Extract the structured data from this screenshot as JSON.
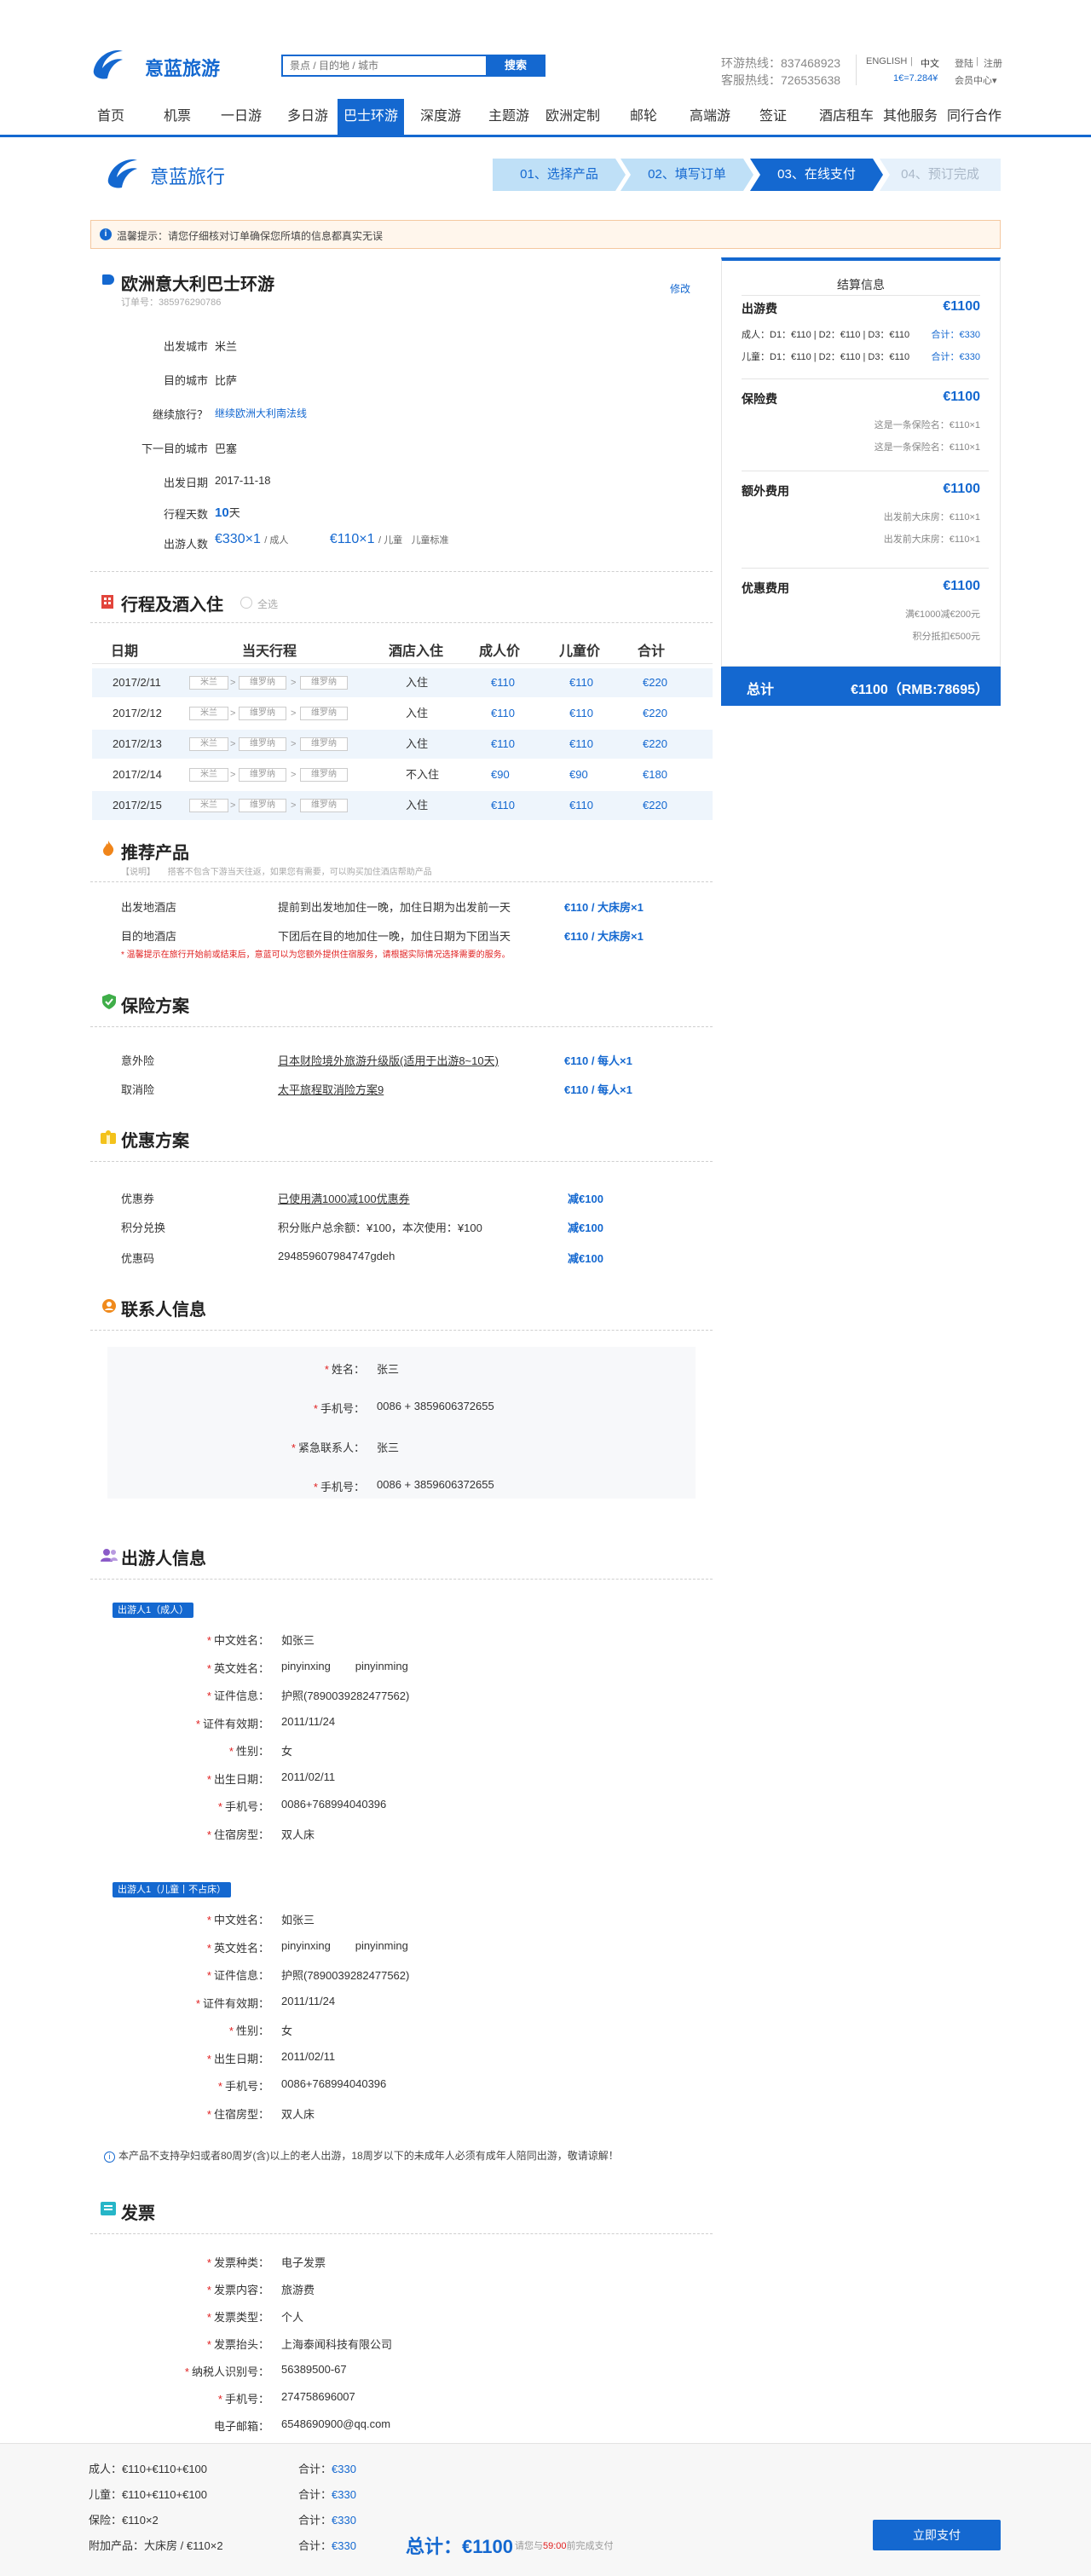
{
  "header": {
    "logo_text": "意蓝旅游",
    "search_placeholder": "景点 / 目的地 / 城市",
    "search_button": "搜索",
    "hotline1": "环游热线：837468923",
    "hotline2": "客服热线：726535638",
    "lang_en": "ENGLISH",
    "lang_sep": "|",
    "lang_zh": "中文",
    "rate": "1€=7.284¥",
    "login": "登陆",
    "login_sep": "|",
    "register": "注册",
    "member": "会员中心",
    "member_caret": "▾"
  },
  "nav": [
    "首页",
    "机票",
    "一日游",
    "多日游",
    "巴士环游",
    "深度游",
    "主题游",
    "欧洲定制",
    "邮轮",
    "高端游",
    "签证",
    "酒店租车",
    "其他服务",
    "同行合作"
  ],
  "brand2": "意蓝旅行",
  "steps": [
    "01、选择产品",
    "02、填写订单",
    "03、在线支付",
    "04、预订完成"
  ],
  "notice": "温馨提示：请您仔细核对订单确保您所填的信息都真实无误",
  "product": {
    "title": "欧洲意大利巴士环游",
    "order_no": "订单号：385976290786",
    "edit": "修改",
    "rows": [
      {
        "label": "出发城市",
        "value": "米兰"
      },
      {
        "label": "目的城市",
        "value": "比萨"
      },
      {
        "label": "继续旅行？",
        "value": "继续欧洲大利南法线"
      },
      {
        "label": "下一目的城市",
        "value": "巴塞"
      },
      {
        "label": "出发日期",
        "value": "2017-11-18"
      }
    ],
    "days_label": "行程天数",
    "days_value": "10",
    "days_unit": "天",
    "pax_label": "出游人数",
    "adult_price": "€330×1",
    "adult_unit": "/ 成人",
    "child_price": "€110×1",
    "child_unit": "/ 儿童",
    "child_note": "儿童标准"
  },
  "itinerary": {
    "title": "行程及酒入住",
    "option": "全选",
    "headers": [
      "日期",
      "当天行程",
      "酒店入住",
      "成人价",
      "儿童价",
      "合计"
    ],
    "rows": [
      {
        "date": "2017/2/11",
        "c1": "米兰",
        "c2": "维罗纳",
        "c3": "维罗纳",
        "hotel": "入住",
        "adult": "€110",
        "child": "€110",
        "total": "€220"
      },
      {
        "date": "2017/2/12",
        "c1": "米兰",
        "c2": "维罗纳",
        "c3": "维罗纳",
        "hotel": "入住",
        "adult": "€110",
        "child": "€110",
        "total": "€220"
      },
      {
        "date": "2017/2/13",
        "c1": "米兰",
        "c2": "维罗纳",
        "c3": "维罗纳",
        "hotel": "入住",
        "adult": "€110",
        "child": "€110",
        "total": "€220"
      },
      {
        "date": "2017/2/14",
        "c1": "米兰",
        "c2": "维罗纳",
        "c3": "维罗纳",
        "hotel": "不入住",
        "adult": "€90",
        "child": "€90",
        "total": "€180"
      },
      {
        "date": "2017/2/15",
        "c1": "米兰",
        "c2": "维罗纳",
        "c3": "维罗纳",
        "hotel": "入住",
        "adult": "€110",
        "child": "€110",
        "total": "€220"
      }
    ],
    "arrow": ">"
  },
  "recommend": {
    "title": "推荐产品",
    "note_tag": "【说明】",
    "note": "搭客不包含下游当天往返，如果您有需要，可以购买加住酒店帮助产品",
    "rows": [
      {
        "label": "出发地酒店",
        "desc": "提前到出发地加住一晚，加住日期为出发前一天",
        "price": "€110 / 大床房×1"
      },
      {
        "label": "目的地酒店",
        "desc": "下团后在目的地加住一晚，加住日期为下团当天",
        "price": "€110 / 大床房×1"
      }
    ],
    "warn": "* 温馨提示在旅行开始前或结束后，意蓝可以为您额外提供住宿服务，请根据实际情况选择需要的服务。"
  },
  "insurance": {
    "title": "保险方案",
    "rows": [
      {
        "label": "意外险",
        "desc": "日本财险境外旅游升级版(适用于出游8~10天)",
        "price": "€110 / 每人×1"
      },
      {
        "label": "取消险",
        "desc": "太平旅程取消险方案9",
        "price": "€110 / 每人×1"
      }
    ]
  },
  "discount": {
    "title": "优惠方案",
    "rows": [
      {
        "label": "优惠券",
        "desc": "已使用满1000减100优惠券",
        "price": "减€100"
      },
      {
        "label": "积分兑换",
        "desc": "积分账户总余额：¥100，本次使用：¥100",
        "price": "减€100"
      },
      {
        "label": "优惠码",
        "desc": "294859607984747gdeh",
        "price": "减€100"
      }
    ]
  },
  "contact": {
    "title": "联系人信息",
    "rows": [
      {
        "label": "姓名：",
        "value": "张三"
      },
      {
        "label": "手机号：",
        "value": "0086 + 3859606372655"
      },
      {
        "label": "紧急联系人：",
        "value": "张三"
      },
      {
        "label": "手机号：",
        "value": "0086 + 3859606372655"
      }
    ]
  },
  "travelers": {
    "title": "出游人信息",
    "groups": [
      {
        "badge": "出游人1（成人）",
        "rows": [
          {
            "label": "中文姓名：",
            "value": "如张三"
          },
          {
            "label": "英文姓名：",
            "value": "pinyinxing        pinyinming"
          },
          {
            "label": "证件信息：",
            "value": "护照(7890039282477562)"
          },
          {
            "label": "证件有效期：",
            "value": "2011/11/24"
          },
          {
            "label": "性别：",
            "value": "女"
          },
          {
            "label": "出生日期：",
            "value": "2011/02/11"
          },
          {
            "label": "手机号：",
            "value": "0086+768994040396"
          },
          {
            "label": "住宿房型：",
            "value": "双人床"
          }
        ]
      },
      {
        "badge": "出游人1（儿童丨不占床）",
        "rows": [
          {
            "label": "中文姓名：",
            "value": "如张三"
          },
          {
            "label": "英文姓名：",
            "value": "pinyinxing        pinyinming"
          },
          {
            "label": "证件信息：",
            "value": "护照(7890039282477562)"
          },
          {
            "label": "证件有效期：",
            "value": "2011/11/24"
          },
          {
            "label": "性别：",
            "value": "女"
          },
          {
            "label": "出生日期：",
            "value": "2011/02/11"
          },
          {
            "label": "手机号：",
            "value": "0086+768994040396"
          },
          {
            "label": "住宿房型：",
            "value": "双人床"
          }
        ]
      }
    ],
    "tip": "本产品不支持孕妇或者80周岁(含)以上的老人出游，18周岁以下的未成年人必须有成年人陪同出游，敬请谅解！"
  },
  "invoice": {
    "title": "发票",
    "rows": [
      {
        "label": "发票种类：",
        "value": "电子发票",
        "req": true
      },
      {
        "label": "发票内容：",
        "value": "旅游费",
        "req": true
      },
      {
        "label": "发票类型：",
        "value": "个人",
        "req": true
      },
      {
        "label": "发票抬头：",
        "value": "上海泰闻科技有限公司",
        "req": true
      },
      {
        "label": "纳税人识别号：",
        "value": "56389500-67",
        "req": true
      },
      {
        "label": "手机号：",
        "value": "274758696007",
        "req": true
      },
      {
        "label": "电子邮箱：",
        "value": "6548690900@qq.com",
        "req": false
      }
    ]
  },
  "summary": {
    "title": "结算信息",
    "sections": [
      {
        "label": "出游费",
        "amount": "€1100",
        "lines": [
          {
            "text": "成人：D1：€110 | D2：€110 | D3：€110",
            "note": "合计：€330"
          },
          {
            "text": "儿童：D1：€110 | D2：€110 | D3：€110",
            "note": "合计：€330"
          }
        ]
      },
      {
        "label": "保险费",
        "amount": "€1100",
        "lines": [
          {
            "text": "这是一条保险名：€110×1"
          },
          {
            "text": "这是一条保险名：€110×1"
          }
        ]
      },
      {
        "label": "额外费用",
        "amount": "€1100",
        "lines": [
          {
            "text": "出发前大床房：€110×1"
          },
          {
            "text": "出发前大床房：€110×1"
          }
        ]
      },
      {
        "label": "优惠费用",
        "amount": "€1100",
        "lines": [
          {
            "text": "满€1000减€200元"
          },
          {
            "text": "积分抵扣€500元"
          }
        ]
      }
    ],
    "total_label": "总计",
    "total_value": "€1100（RMB:78695）"
  },
  "footer": {
    "lines": [
      {
        "label": "成人：€110+€110+€100",
        "sum": "合计：",
        "amt": "€330"
      },
      {
        "label": "儿童：€110+€110+€100",
        "sum": "合计：",
        "amt": "€330"
      },
      {
        "label": "保险：€110×2",
        "sum": "合计：",
        "amt": "€330"
      },
      {
        "label": "附加产品：大床房 / €110×2",
        "sum": "合计：",
        "amt": "€330"
      }
    ],
    "total": "总计：€1100",
    "pay_hint_pre": "请您与",
    "pay_hint_time": "59:00",
    "pay_hint_post": "前完成支付",
    "pay_button": "立即支付"
  },
  "colors": {
    "primary": "#1468d0",
    "light_step": "#bfe0f7",
    "notice_bg": "#fff6ec",
    "notice_border": "#f4c8a0",
    "footer_bg": "#f7f7f7"
  }
}
